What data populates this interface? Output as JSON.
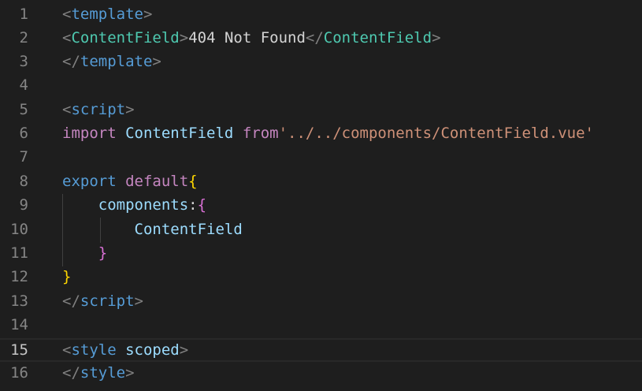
{
  "editor": {
    "current_line": 15,
    "lines": [
      {
        "number": "1",
        "tokens": [
          {
            "text": "<"
          },
          {
            "text": "template"
          },
          {
            "text": ">"
          }
        ]
      },
      {
        "number": "2",
        "tokens": [
          {
            "text": "<"
          },
          {
            "text": "ContentField"
          },
          {
            "text": ">"
          },
          {
            "text": "404 Not Found"
          },
          {
            "text": "</"
          },
          {
            "text": "ContentField"
          },
          {
            "text": ">"
          }
        ]
      },
      {
        "number": "3",
        "tokens": [
          {
            "text": "</"
          },
          {
            "text": "template"
          },
          {
            "text": ">"
          }
        ]
      },
      {
        "number": "4",
        "tokens": []
      },
      {
        "number": "5",
        "tokens": [
          {
            "text": "<"
          },
          {
            "text": "script"
          },
          {
            "text": ">"
          }
        ]
      },
      {
        "number": "6",
        "tokens": [
          {
            "text": "import"
          },
          {
            "text": " "
          },
          {
            "text": "ContentField"
          },
          {
            "text": " "
          },
          {
            "text": "from"
          },
          {
            "text": "'../../components/ContentField.vue'"
          }
        ]
      },
      {
        "number": "7",
        "tokens": []
      },
      {
        "number": "8",
        "tokens": [
          {
            "text": "export"
          },
          {
            "text": " "
          },
          {
            "text": "default"
          },
          {
            "text": "{"
          }
        ]
      },
      {
        "number": "9",
        "tokens": [
          {
            "text": "    "
          },
          {
            "text": "components"
          },
          {
            "text": ":"
          },
          {
            "text": "{"
          }
        ]
      },
      {
        "number": "10",
        "tokens": [
          {
            "text": "        "
          },
          {
            "text": "ContentField"
          }
        ]
      },
      {
        "number": "11",
        "tokens": [
          {
            "text": "    "
          },
          {
            "text": "}"
          }
        ]
      },
      {
        "number": "12",
        "tokens": [
          {
            "text": "}"
          }
        ]
      },
      {
        "number": "13",
        "tokens": [
          {
            "text": "</"
          },
          {
            "text": "script"
          },
          {
            "text": ">"
          }
        ]
      },
      {
        "number": "14",
        "tokens": []
      },
      {
        "number": "15",
        "tokens": [
          {
            "text": "<"
          },
          {
            "text": "style"
          },
          {
            "text": " "
          },
          {
            "text": "scoped"
          },
          {
            "text": ">"
          }
        ]
      },
      {
        "number": "16",
        "tokens": [
          {
            "text": "</"
          },
          {
            "text": "style"
          },
          {
            "text": ">"
          }
        ]
      }
    ]
  },
  "colors": {
    "background": "#1e1e1e",
    "line_number": "#858585",
    "current_line_number": "#c6c6c6",
    "punctuation": "#808080",
    "html_tag": "#569cd6",
    "component_tag": "#4ec9b0",
    "keyword_control": "#c586c0",
    "variable": "#9cdcfe",
    "string": "#ce9178",
    "bracket_level_1": "#ffd700",
    "bracket_level_2": "#da70d6"
  }
}
